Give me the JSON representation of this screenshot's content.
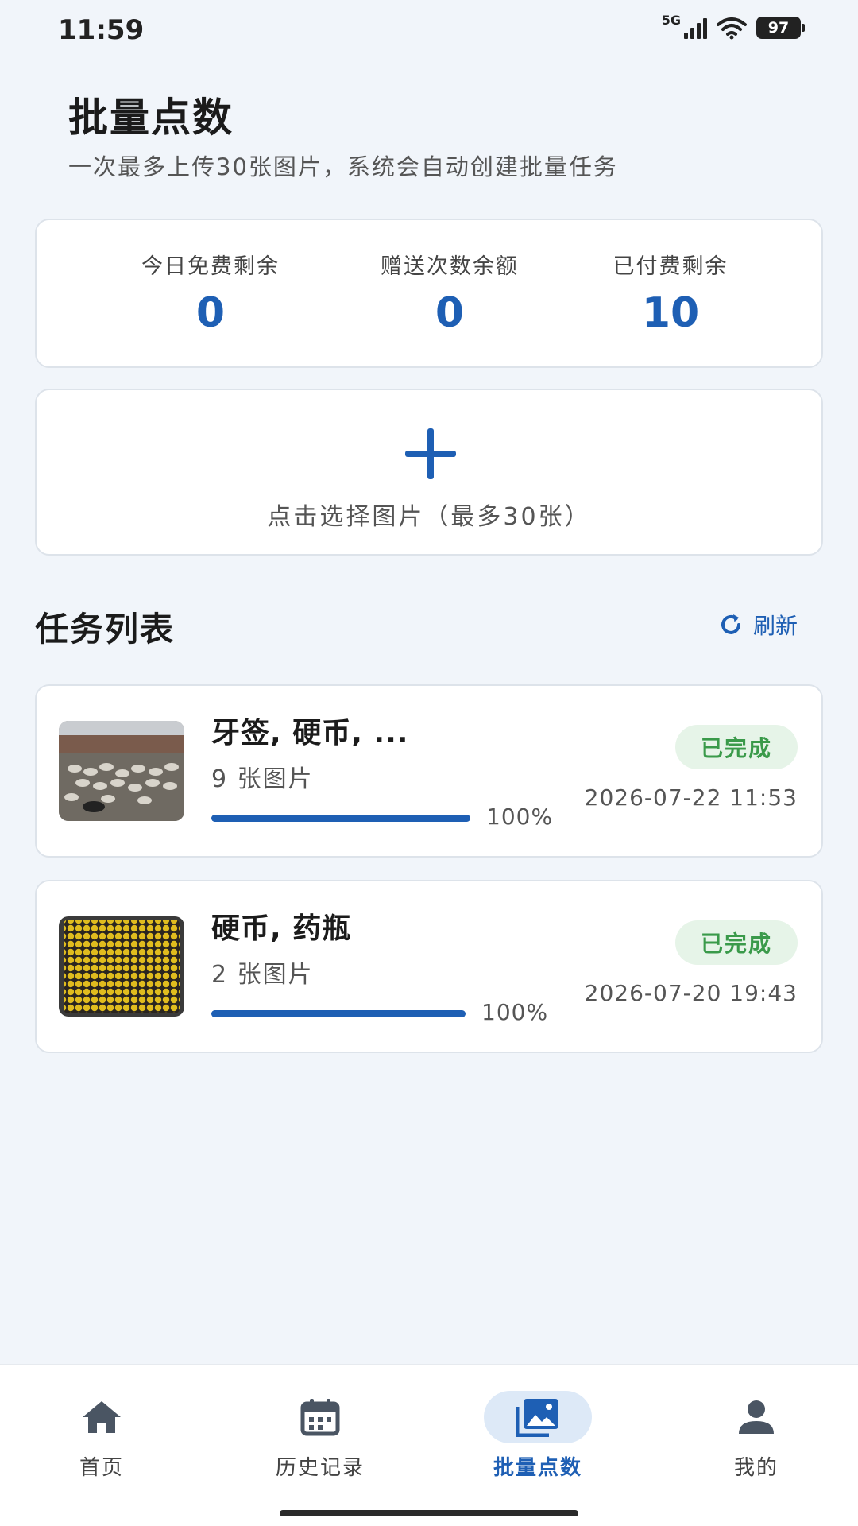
{
  "status_bar": {
    "time": "11:59",
    "network": "5G",
    "battery": "97"
  },
  "header": {
    "title": "批量点数",
    "subtitle": "一次最多上传30张图片，系统会自动创建批量任务"
  },
  "stats": [
    {
      "label": "今日免费剩余",
      "value": "0"
    },
    {
      "label": "赠送次数余额",
      "value": "0"
    },
    {
      "label": "已付费剩余",
      "value": "10"
    }
  ],
  "upload": {
    "label": "点击选择图片（最多30张）",
    "icon": "plus-icon"
  },
  "task_list": {
    "title": "任务列表",
    "refresh_label": "刷新",
    "tasks": [
      {
        "name": "牙签, 硬币, ...",
        "count": "9 张图片",
        "progress": 1.0,
        "progress_label": "100%",
        "status": "已完成",
        "date": "2026-07-22 11:53",
        "thumbnail": "sheep-photo"
      },
      {
        "name": "硬币, 药瓶",
        "count": "2 张图片",
        "progress": 1.0,
        "progress_label": "100%",
        "status": "已完成",
        "date": "2026-07-20 19:43",
        "thumbnail": "yellow-pills-photo"
      }
    ]
  },
  "bottom_nav": {
    "items": [
      {
        "label": "首页",
        "icon": "home-icon"
      },
      {
        "label": "历史记录",
        "icon": "calendar-icon"
      },
      {
        "label": "批量点数",
        "icon": "image-icon",
        "active": true
      },
      {
        "label": "我的",
        "icon": "person-icon"
      }
    ]
  },
  "colors": {
    "accent": "#1e5fb4",
    "background": "#f1f5fa",
    "success": "#3a9a4a",
    "success_bg": "#e6f4e8"
  }
}
